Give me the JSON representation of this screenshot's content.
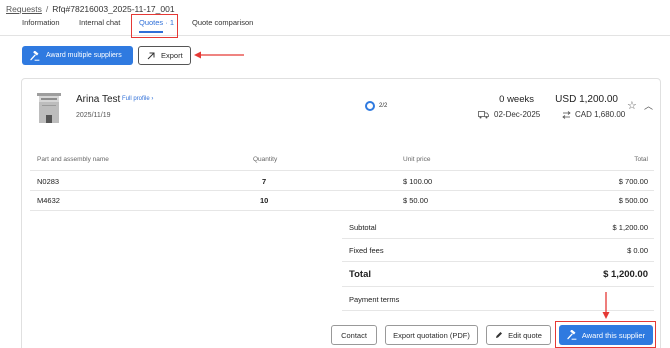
{
  "breadcrumb": {
    "parent": "Requests",
    "separator": "/",
    "current": "Rfq#78216003_2025-11-17_001"
  },
  "tabs": [
    {
      "label": "Information"
    },
    {
      "label": "Internal chat"
    },
    {
      "label": "Quotes · 1"
    },
    {
      "label": "Quote comparison"
    }
  ],
  "toolbar": {
    "award_multiple_label": "Award multiple suppliers",
    "export_label": "Export"
  },
  "quote": {
    "supplier_name": "Arina Test",
    "full_profile_label": "Full profile",
    "date": "2025/11/19",
    "progress": "2/2",
    "lead_time": "0 weeks",
    "delivery_date": "02-Dec-2025",
    "price_usd": "USD 1,200.00",
    "price_cad": "CAD 1,680.00"
  },
  "table": {
    "headers": [
      "Part and assembly name",
      "Quantity",
      "Unit price",
      "Total"
    ],
    "rows": [
      {
        "name": "N0283",
        "quantity": "7",
        "unit_price": "$ 100.00",
        "total": "$ 700.00"
      },
      {
        "name": "M4632",
        "quantity": "10",
        "unit_price": "$ 50.00",
        "total": "$ 500.00"
      }
    ]
  },
  "summary": {
    "subtotal_label": "Subtotal",
    "subtotal_value": "$ 1,200.00",
    "fixed_fees_label": "Fixed fees",
    "fixed_fees_value": "$ 0.00",
    "total_label": "Total",
    "total_value": "$ 1,200.00",
    "payment_terms_label": "Payment terms"
  },
  "actions": {
    "contact_label": "Contact",
    "export_pdf_label": "Export quotation (PDF)",
    "edit_label": "Edit quote",
    "award_label": "Award this supplier"
  },
  "colors": {
    "accent": "#2f7ae0",
    "annotation": "#e53935"
  }
}
